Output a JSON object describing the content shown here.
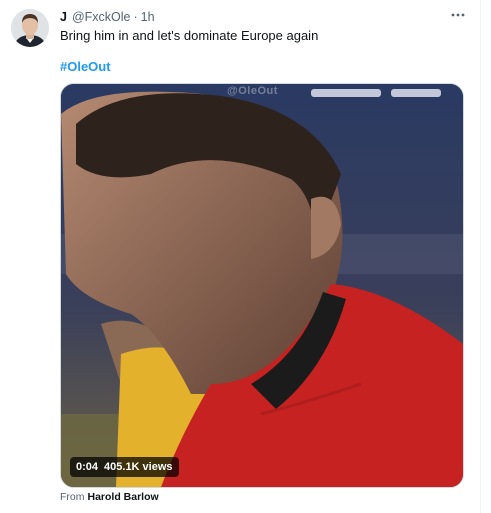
{
  "tweet": {
    "display_name": "J",
    "handle": "@FxckOle",
    "separator": "·",
    "time": "1h",
    "text": "Bring him in and let's dominate Europe again",
    "hashtag": "#OleOut",
    "more_icon": "more-horizontal-icon",
    "avatar_icon": "profile-avatar"
  },
  "media": {
    "watermark": "@OleOut",
    "duration": "0:04",
    "views": "405.1K views"
  },
  "attribution": {
    "prefix": "From",
    "source": "Harold Barlow"
  },
  "colors": {
    "link": "#1d9bf0",
    "text": "#0f1419",
    "secondary": "#536471",
    "border": "#cfd9de"
  }
}
